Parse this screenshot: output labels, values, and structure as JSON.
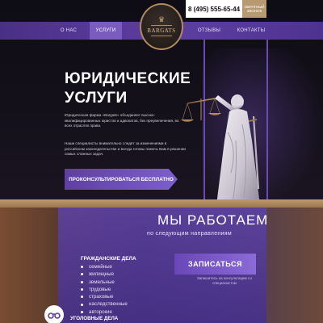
{
  "header": {
    "phone": "8 (495) 555-65-44",
    "callback_label": "ОБРАТНЫЙ ЗВОНОК",
    "logo_text": "BARGATS"
  },
  "nav": {
    "items": [
      {
        "label": "О НАС",
        "active": false
      },
      {
        "label": "УСЛУГИ",
        "active": true
      },
      {
        "label": "ОТЗЫВЫ",
        "active": false
      },
      {
        "label": "КОНТАКТЫ",
        "active": false
      }
    ]
  },
  "hero": {
    "title_line1": "ЮРИДИЧЕСКИЕ",
    "title_line2": "УСЛУГИ",
    "paragraph1": "Юридическая фирма «Bargats» объединяет высоко-квалифицированных юристов и адвокатов, без преувеличения, во всех отраслях права.",
    "paragraph2": "Наши специалисты внимательно следят за изменениями в российском законодательстве и всегда готовы помочь Вам в решении самых сложных задач.",
    "cta_label": "ПРОКОНСУЛЬТИРОВАТЬСЯ БЕСПЛАТНО"
  },
  "services": {
    "title": "МЫ РАБОТАЕМ",
    "subtitle": "по следующим направлениям",
    "category1": {
      "title": "ГРАЖДАНСКИЕ ДЕЛА",
      "items": [
        "семейные",
        "жилищные",
        "земельные",
        "трудовые",
        "страховые",
        "наследственные",
        "авторские"
      ]
    },
    "signup_label": "ЗАПИСАТЬСЯ",
    "signup_note": "Запишитесь на консультацию со специалистом",
    "category2": {
      "title": "УГОЛОВНЫЕ ДЕЛА"
    }
  },
  "icons": {
    "logo": "crown-emblem",
    "statue": "lady-justice-statue",
    "category2_icon": "handcuffs-icon"
  },
  "colors": {
    "accent_purple": "#5b3d9f",
    "gold": "#b08a62",
    "dark_bg": "#0e0c14"
  }
}
